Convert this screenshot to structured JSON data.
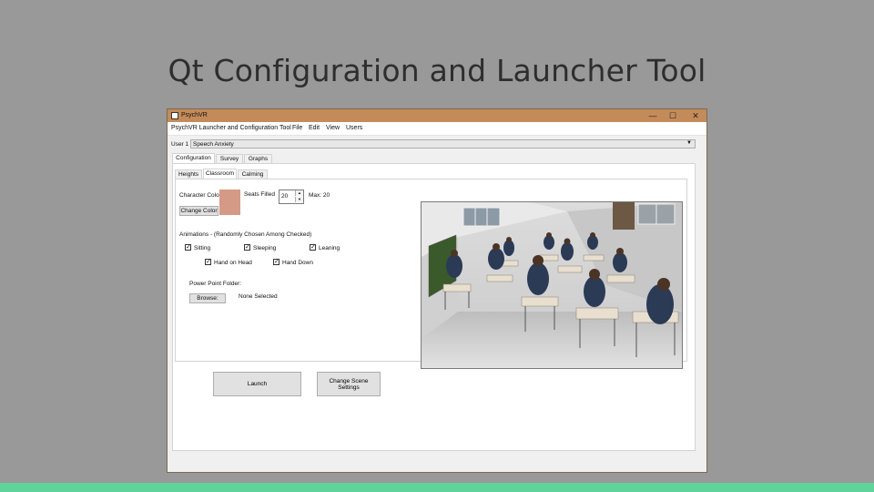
{
  "slide": {
    "title": "Qt Configuration and Launcher Tool"
  },
  "window": {
    "title": "PsychVR",
    "controls": {
      "minimize": "—",
      "maximize": "☐",
      "close": "✕"
    }
  },
  "menu": {
    "app_label": "PsychVR Launcher and Configuration Tool",
    "items": [
      "File",
      "Edit",
      "View",
      "Users"
    ]
  },
  "user": {
    "label": "User 1",
    "selected": "Speech Anxiety"
  },
  "main_tabs": [
    "Configuration",
    "Survey",
    "Graphs"
  ],
  "sub_tabs": [
    "Heights",
    "Classroom",
    "Calming"
  ],
  "classroom": {
    "character_color_label": "Character Color",
    "character_color": "#d49a85",
    "change_color_button": "Change Color",
    "seats_filled_label": "Seats Filled",
    "seats_filled_value": "20",
    "max_label": "Max: 20",
    "animations_heading": "Animations - (Randomly Chosen Among Checked)",
    "animations": [
      {
        "label": "Sitting",
        "checked": true
      },
      {
        "label": "Sleeping",
        "checked": true
      },
      {
        "label": "Leaning",
        "checked": true
      },
      {
        "label": "Hand on Head",
        "checked": true
      },
      {
        "label": "Hand Down",
        "checked": true
      }
    ],
    "power_point_label": "Power Point Folder:",
    "browse_button": "Browse:",
    "folder_status": "None Selected"
  },
  "actions": {
    "launch": "Launch",
    "change_scene": "Change Scene Settings"
  },
  "colors": {
    "titlebar": "#c48b5a",
    "accent_bar": "#5ed39a",
    "background": "#999999"
  }
}
